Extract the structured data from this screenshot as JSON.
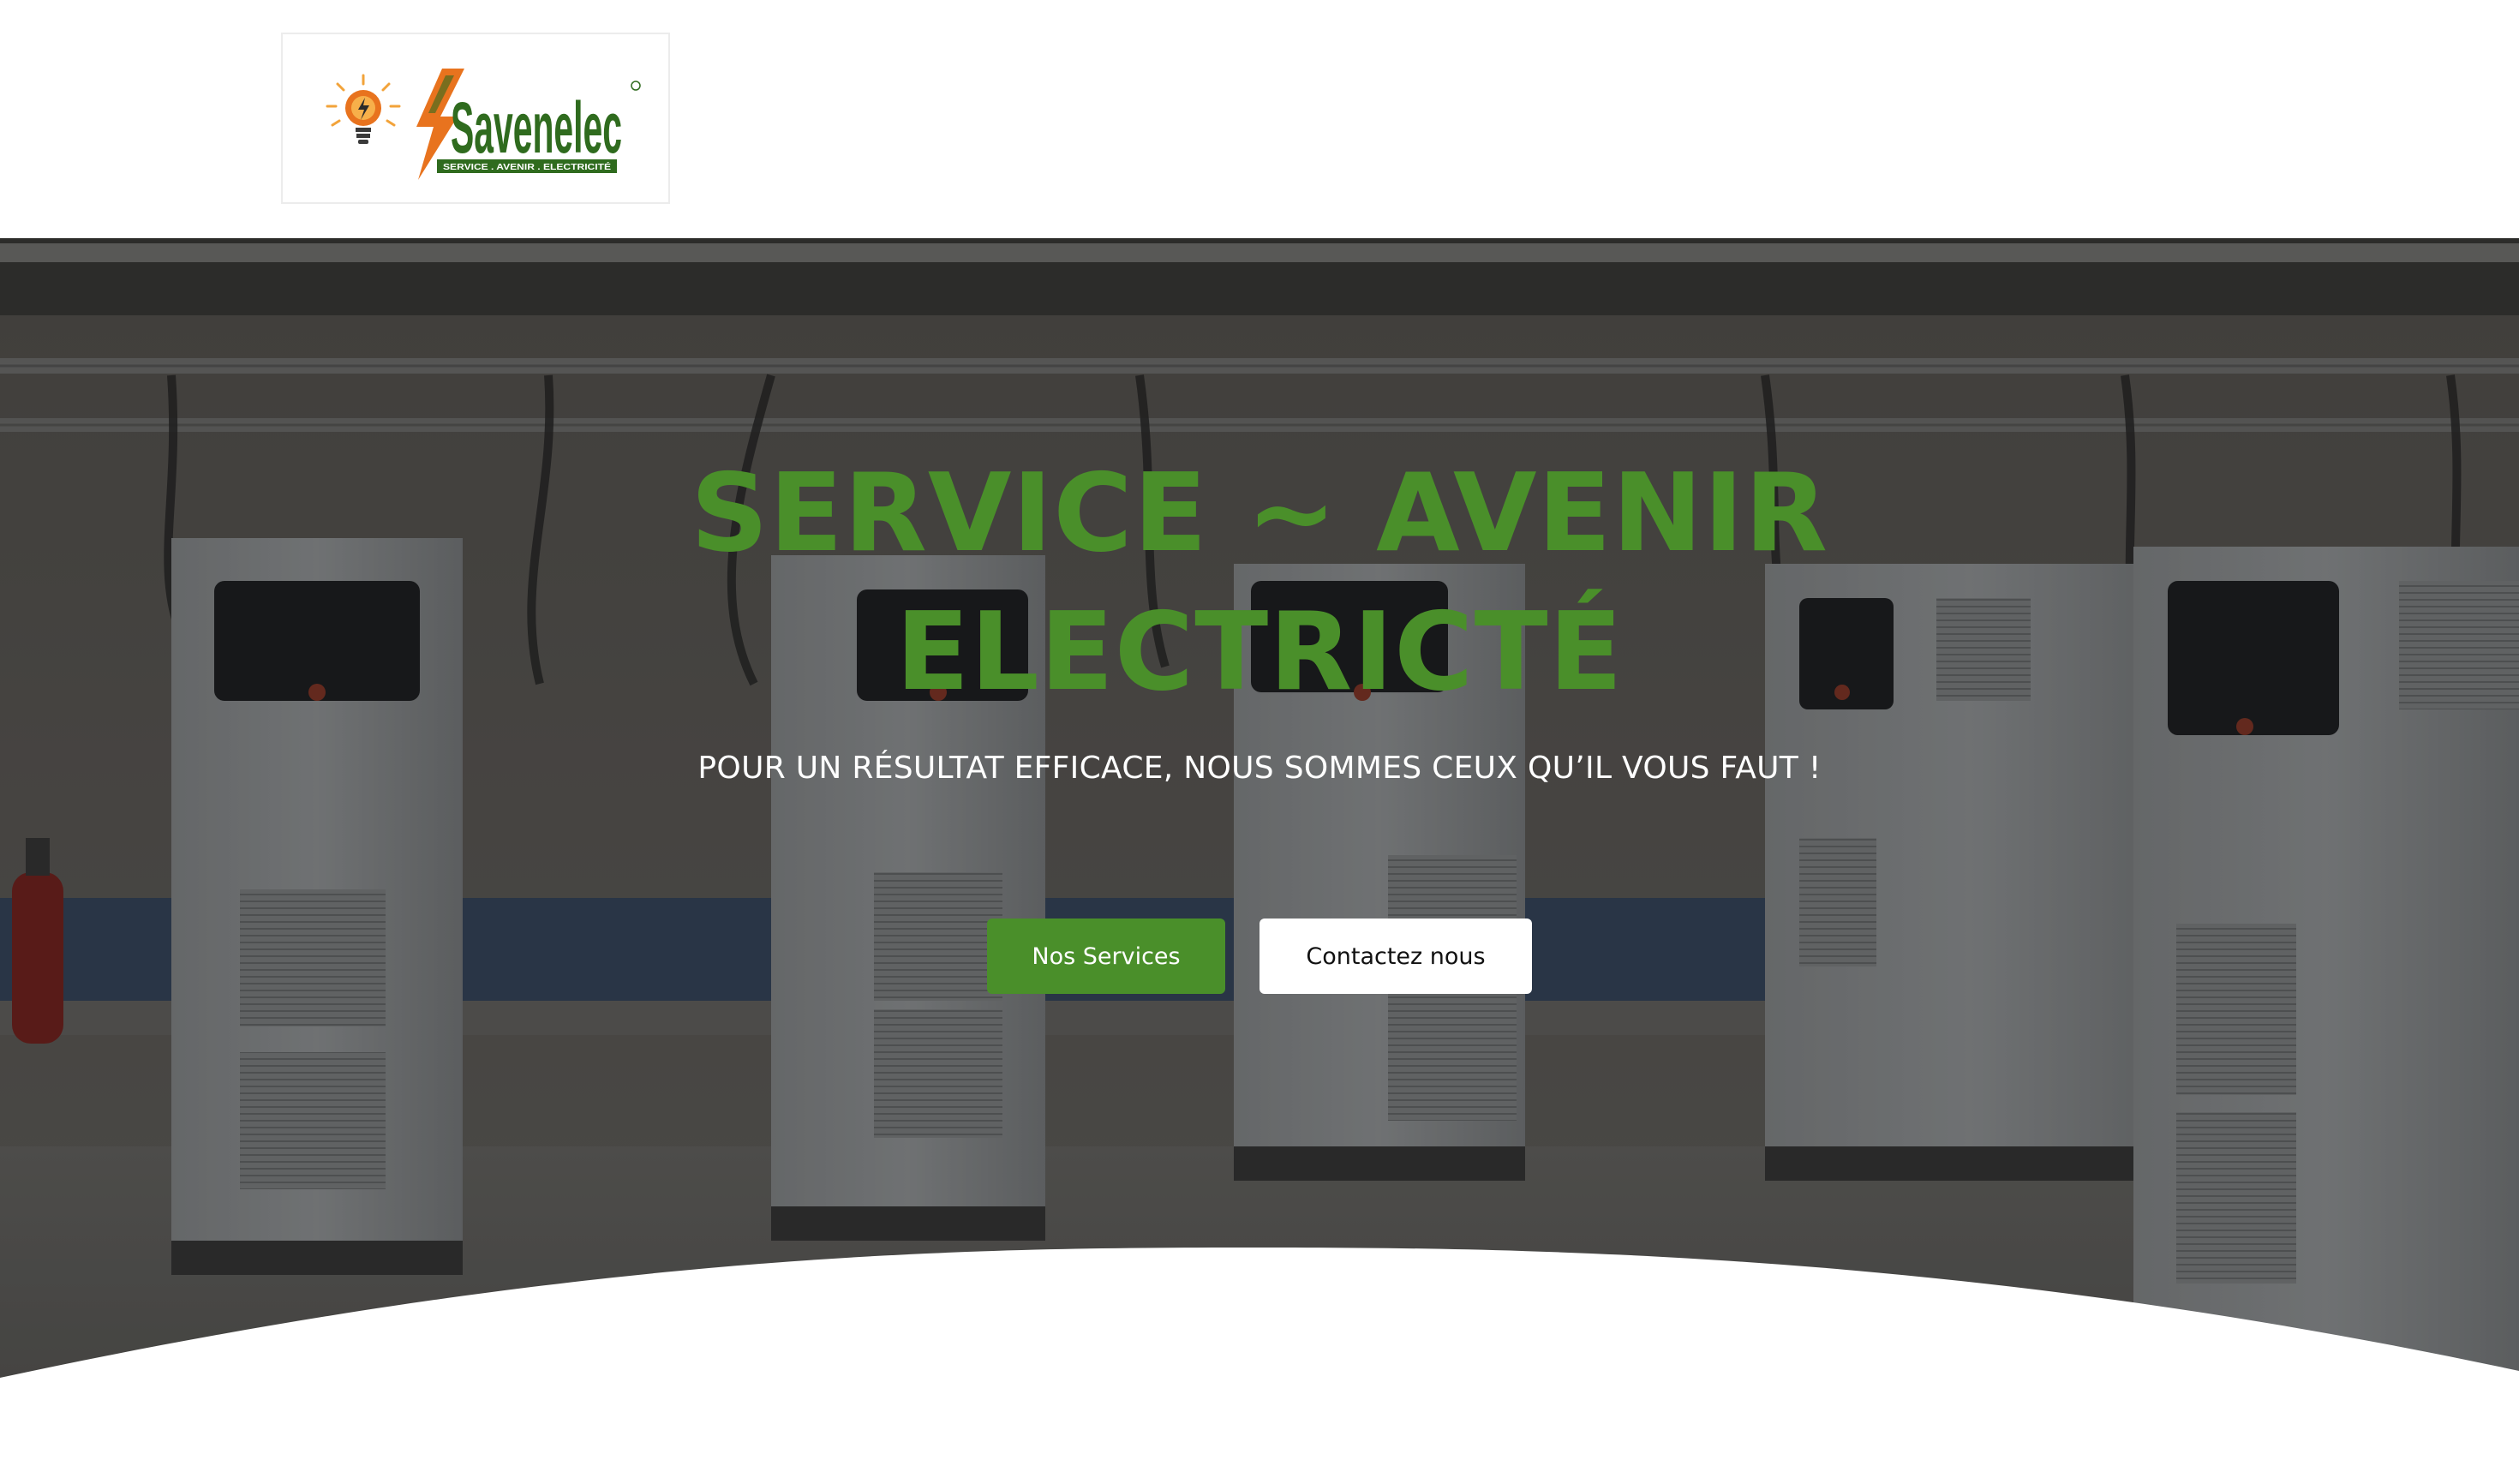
{
  "header": {
    "logo": {
      "brand": "Savenelec",
      "tagline": "SERVICE . AVENIR . ELECTRICITÉ"
    }
  },
  "hero": {
    "title_line1": "SERVICE ~ AVENIR",
    "title_line2": "ELECTRICTÉ",
    "subtitle": "POUR UN RÉSULTAT EFFICACE, NOUS SOMMES CEUX QU’IL VOUS FAUT !",
    "buttons": {
      "services": "Nos Services",
      "contact": "Contactez nous"
    }
  },
  "colors": {
    "accent_green": "#4a8f2a",
    "logo_orange": "#e8731e",
    "logo_green": "#2f6b1e"
  },
  "icons": {
    "bulb": "lightbulb-icon",
    "logo": "savenelec-logo"
  }
}
